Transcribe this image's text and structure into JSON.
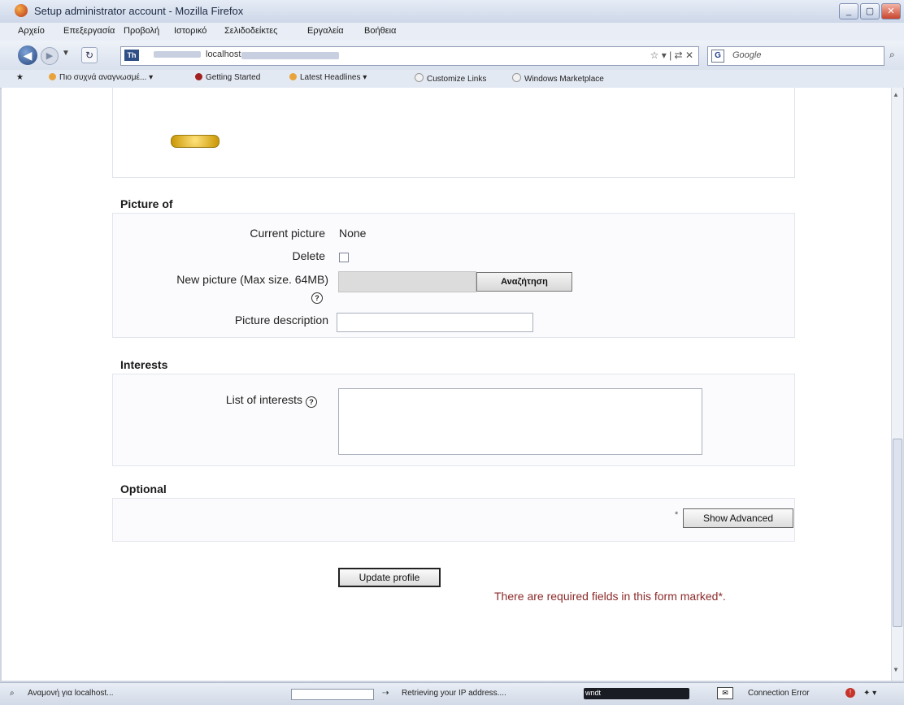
{
  "window": {
    "title": "Setup administrator account - Mozilla Firefox",
    "controls": [
      "_",
      "▢",
      "✕"
    ]
  },
  "menu": [
    "Αρχείο",
    "Επεξεργασία",
    "Προβολή",
    "Ιστορικό",
    "Σελιδοδείκτες",
    "Εργαλεία",
    "Βοήθεια"
  ],
  "navigation": {
    "url": "localhost",
    "url_icons": "☆ ▾ | ⇄ ✕",
    "search_engine": "Google",
    "search_placeholder": "Google"
  },
  "bookmarks": [
    {
      "label": "Πιο συχνά αναγνωσμέ... ▾",
      "color": "#e8a33b"
    },
    {
      "label": "Getting Started",
      "color": "#a32020"
    },
    {
      "label": "Latest Headlines ▾",
      "color": "#e8a33b"
    },
    {
      "label": "Customize Links",
      "color": "#f2f2f2"
    },
    {
      "label": "Windows Marketplace",
      "color": "#f2f2f2"
    }
  ],
  "form": {
    "picture_section": {
      "legend": "Picture of",
      "current_picture_label": "Current picture",
      "current_picture_value": "None",
      "delete_label": "Delete",
      "delete_checked": false,
      "new_picture_label": "New picture (Max size. 64MB)",
      "browse_label": "Αναζήτηση",
      "picture_description_label": "Picture description",
      "picture_description_value": ""
    },
    "interests_section": {
      "legend": "Interests",
      "list_of_interests_label": "List of interests",
      "list_of_interests_value": ""
    },
    "optional_section": {
      "legend": "Optional",
      "show_advanced_label": "Show Advanced",
      "star": "*"
    },
    "update_profile_label": "Update profile",
    "required_note": "There are required fields in this form marked*."
  },
  "status": {
    "left_text": "Αναμονή για localhost...",
    "middle_text": "Retrieving your IP address....",
    "dark_label": "wndt",
    "connection_text": "Connection Error",
    "accent_color": "#8b2a2a"
  }
}
